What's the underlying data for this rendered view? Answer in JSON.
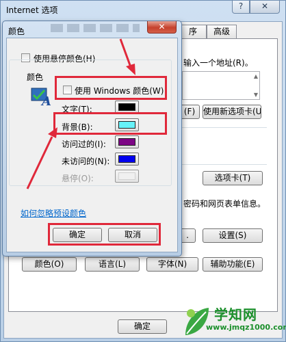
{
  "main_window": {
    "title": "Internet 选项",
    "help_label": "?",
    "close_label": "✕",
    "tabs": [
      "序",
      "高级"
    ],
    "homepage_text": "输入一个地址(R)。",
    "buttons": {
      "f_partial": "(F)",
      "new_tab": "使用新选项卡(U)",
      "tabs": "选项卡(T)",
      "settings": "设置(S)",
      "dot": ".",
      "colors": "颜色(O)",
      "languages": "语言(L)",
      "fonts": "字体(N)",
      "accessibility": "辅助功能(E)",
      "ok": "确定"
    },
    "history_text": "密码和网页表单信息。"
  },
  "dialog": {
    "title": "颜色",
    "close_label": "✕",
    "use_hover_color": "使用悬停颜色(H)",
    "group_label": "颜色",
    "use_windows_colors": "使用 Windows 颜色(W)",
    "colors": [
      {
        "label": "文字(T):",
        "color": "#000000",
        "disabled": false
      },
      {
        "label": "背景(B):",
        "color": "#66f2f8",
        "disabled": false
      },
      {
        "label": "访问过的(I):",
        "color": "#7d0685",
        "disabled": false
      },
      {
        "label": "未访问的(N):",
        "color": "#0000f0",
        "disabled": false
      },
      {
        "label": "悬停(O):",
        "color": "#f0f0f0",
        "disabled": true
      }
    ],
    "link_text": "如何忽略预设颜色",
    "ok": "确定",
    "cancel": "取消"
  },
  "watermark": {
    "text": "学知网",
    "url": "www.jmqz1000.com"
  },
  "accent_color": "#e0283a"
}
